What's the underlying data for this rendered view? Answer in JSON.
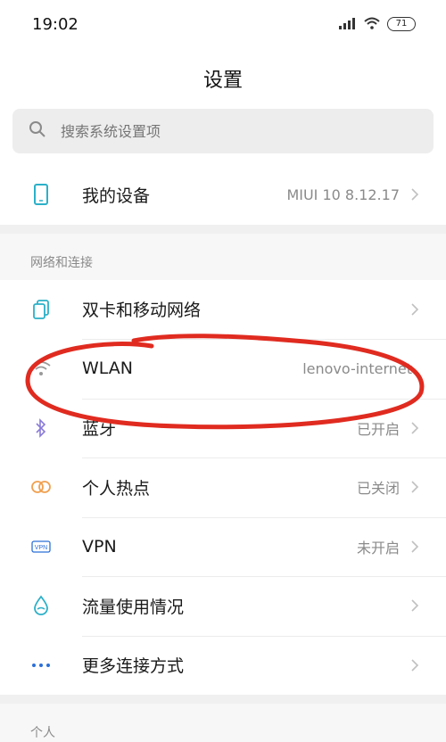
{
  "status_bar": {
    "time": "19:02",
    "battery": "71"
  },
  "header": {
    "title": "设置"
  },
  "search": {
    "placeholder": "搜索系统设置项"
  },
  "device": {
    "label": "我的设备",
    "value": "MIUI 10 8.12.17"
  },
  "network_section": {
    "header": "网络和连接",
    "items": [
      {
        "label": "双卡和移动网络",
        "value": "",
        "icon": "sim-card-icon"
      },
      {
        "label": "WLAN",
        "value": "lenovo-internet",
        "icon": "wifi-icon"
      },
      {
        "label": "蓝牙",
        "value": "已开启",
        "icon": "bluetooth-icon"
      },
      {
        "label": "个人热点",
        "value": "已关闭",
        "icon": "hotspot-icon"
      },
      {
        "label": "VPN",
        "value": "未开启",
        "icon": "vpn-icon"
      },
      {
        "label": "流量使用情况",
        "value": "",
        "icon": "data-usage-icon"
      },
      {
        "label": "更多连接方式",
        "value": "",
        "icon": "more-icon"
      }
    ]
  },
  "personal_section": {
    "header": "个人"
  },
  "colors": {
    "accent": "#2bb0c8",
    "annotation": "#e02b20"
  }
}
